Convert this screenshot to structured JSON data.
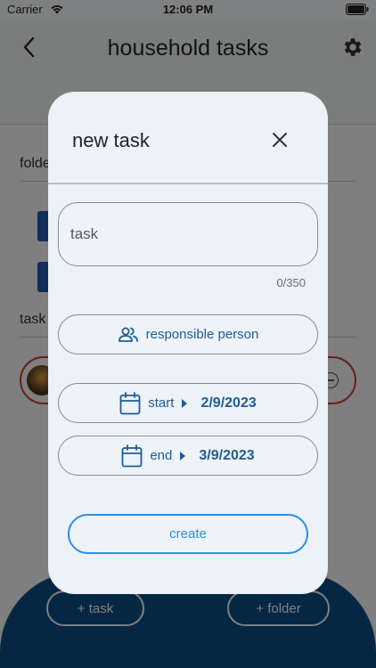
{
  "status_bar": {
    "carrier": "Carrier",
    "time": "12:06 PM"
  },
  "app": {
    "title": "household tasks",
    "folders_label": "folde",
    "tasks_label": "task",
    "add_task_label": "+ task",
    "add_folder_label": "+ folder"
  },
  "modal": {
    "title": "new task",
    "task_placeholder": "task",
    "char_counter": "0/350",
    "responsible_label": "responsible person",
    "start_label": "start",
    "start_date": "2/9/2023",
    "end_label": "end",
    "end_date": "3/9/2023",
    "create_label": "create"
  },
  "colors": {
    "accent": "#1d5d95",
    "create_accent": "#2f8fe6",
    "bottom_panel": "#0a4f88",
    "modal_bg": "#edf1f8",
    "task_border": "#d23a2e"
  },
  "icons": {
    "back": "chevron-left-icon",
    "settings": "gear-icon",
    "close": "close-icon",
    "people": "people-icon",
    "calendar": "calendar-icon",
    "arrow": "caret-right-icon",
    "wifi": "wifi-icon",
    "battery": "battery-icon"
  }
}
